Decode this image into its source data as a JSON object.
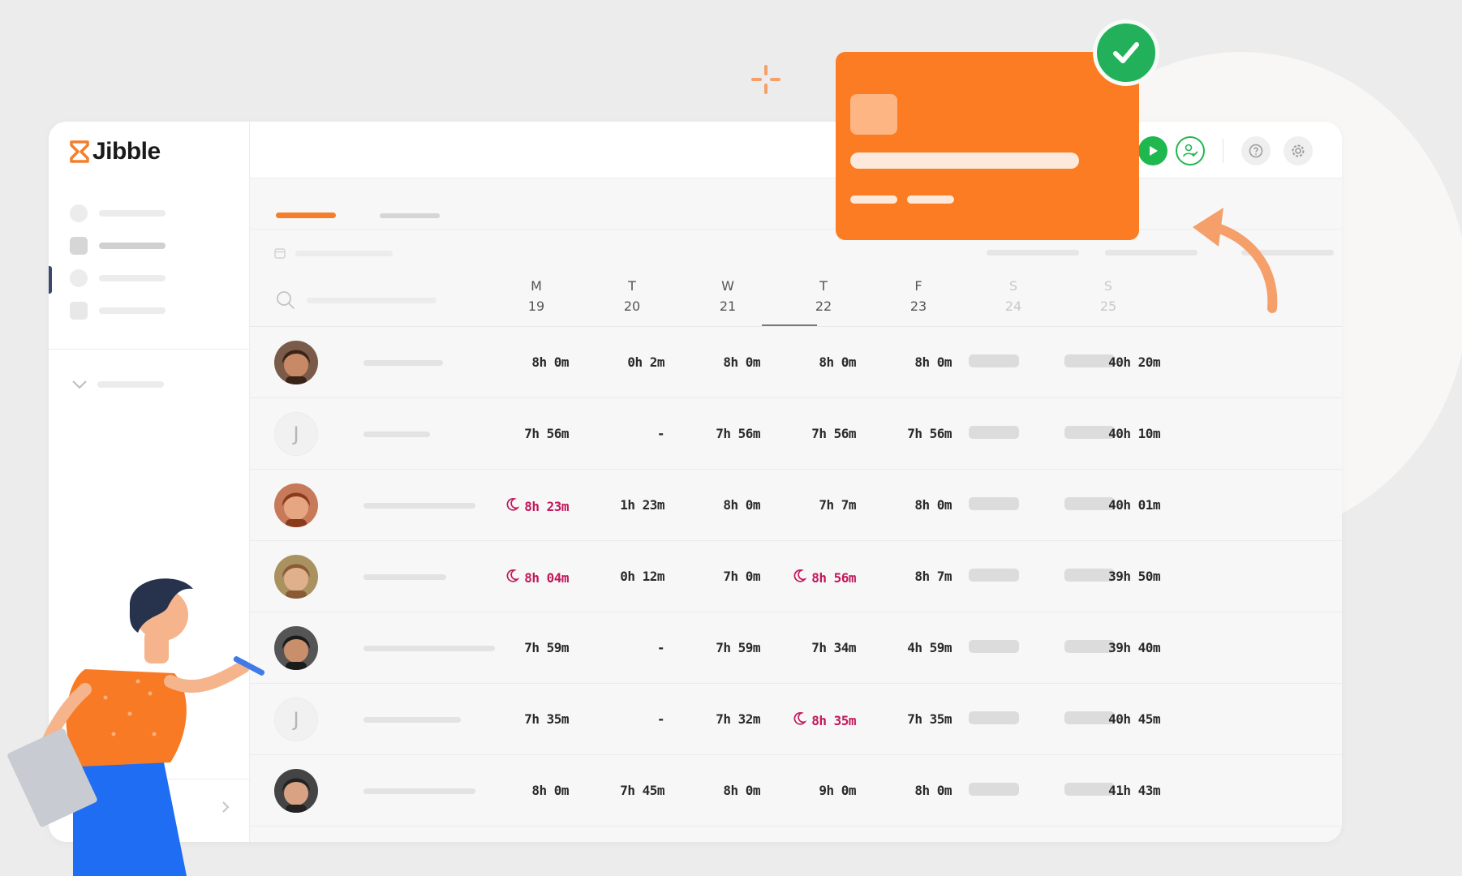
{
  "app": {
    "brand": "Jibble"
  },
  "colors": {
    "accent": "#f47e2a",
    "success": "#1eb84f",
    "overtime": "#c2185b",
    "card": "#fb7c22"
  },
  "icons": {
    "logo": "hourglass-icon",
    "play": "play-icon",
    "user": "user-check-icon",
    "help": "help-icon",
    "settings": "gear-icon",
    "search": "search-icon",
    "calendar": "calendar-icon",
    "overtime": "moon-icon",
    "check": "check-icon"
  },
  "timesheet": {
    "days": [
      {
        "dow": "M",
        "date": "19"
      },
      {
        "dow": "T",
        "date": "20"
      },
      {
        "dow": "W",
        "date": "21"
      },
      {
        "dow": "T",
        "date": "22"
      },
      {
        "dow": "F",
        "date": "23"
      },
      {
        "dow": "S",
        "date": "24"
      },
      {
        "dow": "S",
        "date": "25"
      }
    ],
    "rows": [
      {
        "avatar": "",
        "cells": [
          "8h 0m",
          "0h 2m",
          "8h 0m",
          "8h 0m",
          "8h 0m"
        ],
        "overtime": [
          false,
          false,
          false,
          false,
          false
        ],
        "total": "40h 20m"
      },
      {
        "avatar": "J",
        "cells": [
          "7h 56m",
          "-",
          "7h 56m",
          "7h 56m",
          "7h 56m"
        ],
        "overtime": [
          false,
          false,
          false,
          false,
          false
        ],
        "total": "40h 10m"
      },
      {
        "avatar": "",
        "cells": [
          "8h 23m",
          "1h 23m",
          "8h 0m",
          "7h 7m",
          "8h 0m"
        ],
        "overtime": [
          true,
          false,
          false,
          false,
          false
        ],
        "total": "40h 01m"
      },
      {
        "avatar": "",
        "cells": [
          "8h 04m",
          "0h 12m",
          "7h 0m",
          "8h 56m",
          "8h 7m"
        ],
        "overtime": [
          true,
          false,
          false,
          true,
          false
        ],
        "total": "39h 50m"
      },
      {
        "avatar": "",
        "cells": [
          "7h 59m",
          "-",
          "7h 59m",
          "7h 34m",
          "4h 59m"
        ],
        "overtime": [
          false,
          false,
          false,
          false,
          false
        ],
        "total": "39h 40m"
      },
      {
        "avatar": "J",
        "cells": [
          "7h 35m",
          "-",
          "7h 32m",
          "8h 35m",
          "7h 35m"
        ],
        "overtime": [
          false,
          false,
          false,
          true,
          false
        ],
        "total": "40h 45m"
      },
      {
        "avatar": "",
        "cells": [
          "8h 0m",
          "7h 45m",
          "8h 0m",
          "9h 0m",
          "8h 0m"
        ],
        "overtime": [
          false,
          false,
          false,
          false,
          false
        ],
        "total": "41h 43m"
      }
    ]
  }
}
